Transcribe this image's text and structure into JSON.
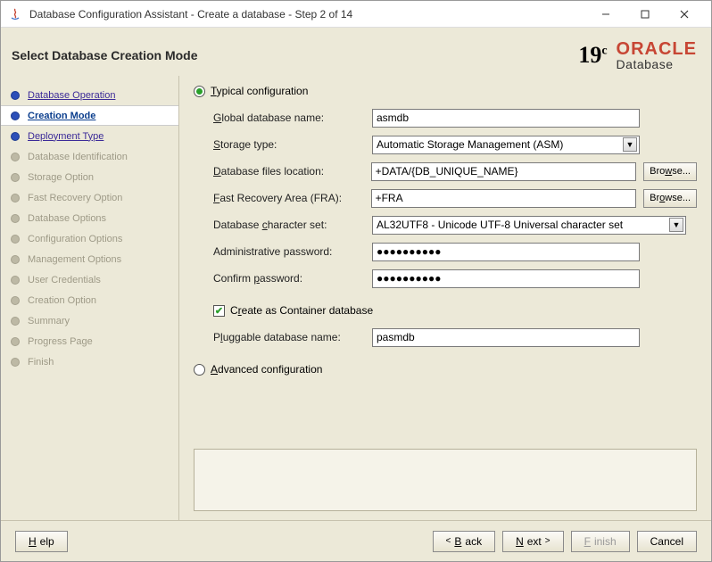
{
  "window": {
    "title": "Database Configuration Assistant - Create a database - Step 2 of 14"
  },
  "header": {
    "pageTitle": "Select Database Creation Mode",
    "brand": {
      "version": "19",
      "versionSuffix": "c",
      "line1": "ORACLE",
      "line2": "Database"
    }
  },
  "steps": [
    {
      "label": "Database Operation",
      "state": "visited"
    },
    {
      "label": "Creation Mode",
      "state": "current"
    },
    {
      "label": "Deployment Type",
      "state": "nextup"
    },
    {
      "label": "Database Identification",
      "state": "future"
    },
    {
      "label": "Storage Option",
      "state": "future"
    },
    {
      "label": "Fast Recovery Option",
      "state": "future"
    },
    {
      "label": "Database Options",
      "state": "future"
    },
    {
      "label": "Configuration Options",
      "state": "future"
    },
    {
      "label": "Management Options",
      "state": "future"
    },
    {
      "label": "User Credentials",
      "state": "future"
    },
    {
      "label": "Creation Option",
      "state": "future"
    },
    {
      "label": "Summary",
      "state": "future"
    },
    {
      "label": "Progress Page",
      "state": "future"
    },
    {
      "label": "Finish",
      "state": "future"
    }
  ],
  "radios": {
    "typical": "Typical configuration",
    "advanced": "Advanced configuration"
  },
  "form": {
    "globalDbName": {
      "label": "Global database name:",
      "value": "asmdb"
    },
    "storageType": {
      "label": "Storage type:",
      "value": "Automatic Storage Management (ASM)"
    },
    "dbFilesLoc": {
      "label": "Database files location:",
      "value": "+DATA/{DB_UNIQUE_NAME}"
    },
    "fra": {
      "label": "Fast Recovery Area (FRA):",
      "value": "+FRA"
    },
    "charset": {
      "label": "Database character set:",
      "value": "AL32UTF8 - Unicode UTF-8 Universal character set"
    },
    "adminPw": {
      "label": "Administrative password:",
      "value": "●●●●●●●●●●"
    },
    "confirmPw": {
      "label": "Confirm password:",
      "value": "●●●●●●●●●●"
    },
    "containerChk": {
      "label": "Create as Container database"
    },
    "pdbName": {
      "label": "Pluggable database name:",
      "value": "pasmdb"
    },
    "browse": "Browse..."
  },
  "footer": {
    "help": "Help",
    "back": "Back",
    "next": "Next",
    "finish": "Finish",
    "cancel": "Cancel"
  }
}
